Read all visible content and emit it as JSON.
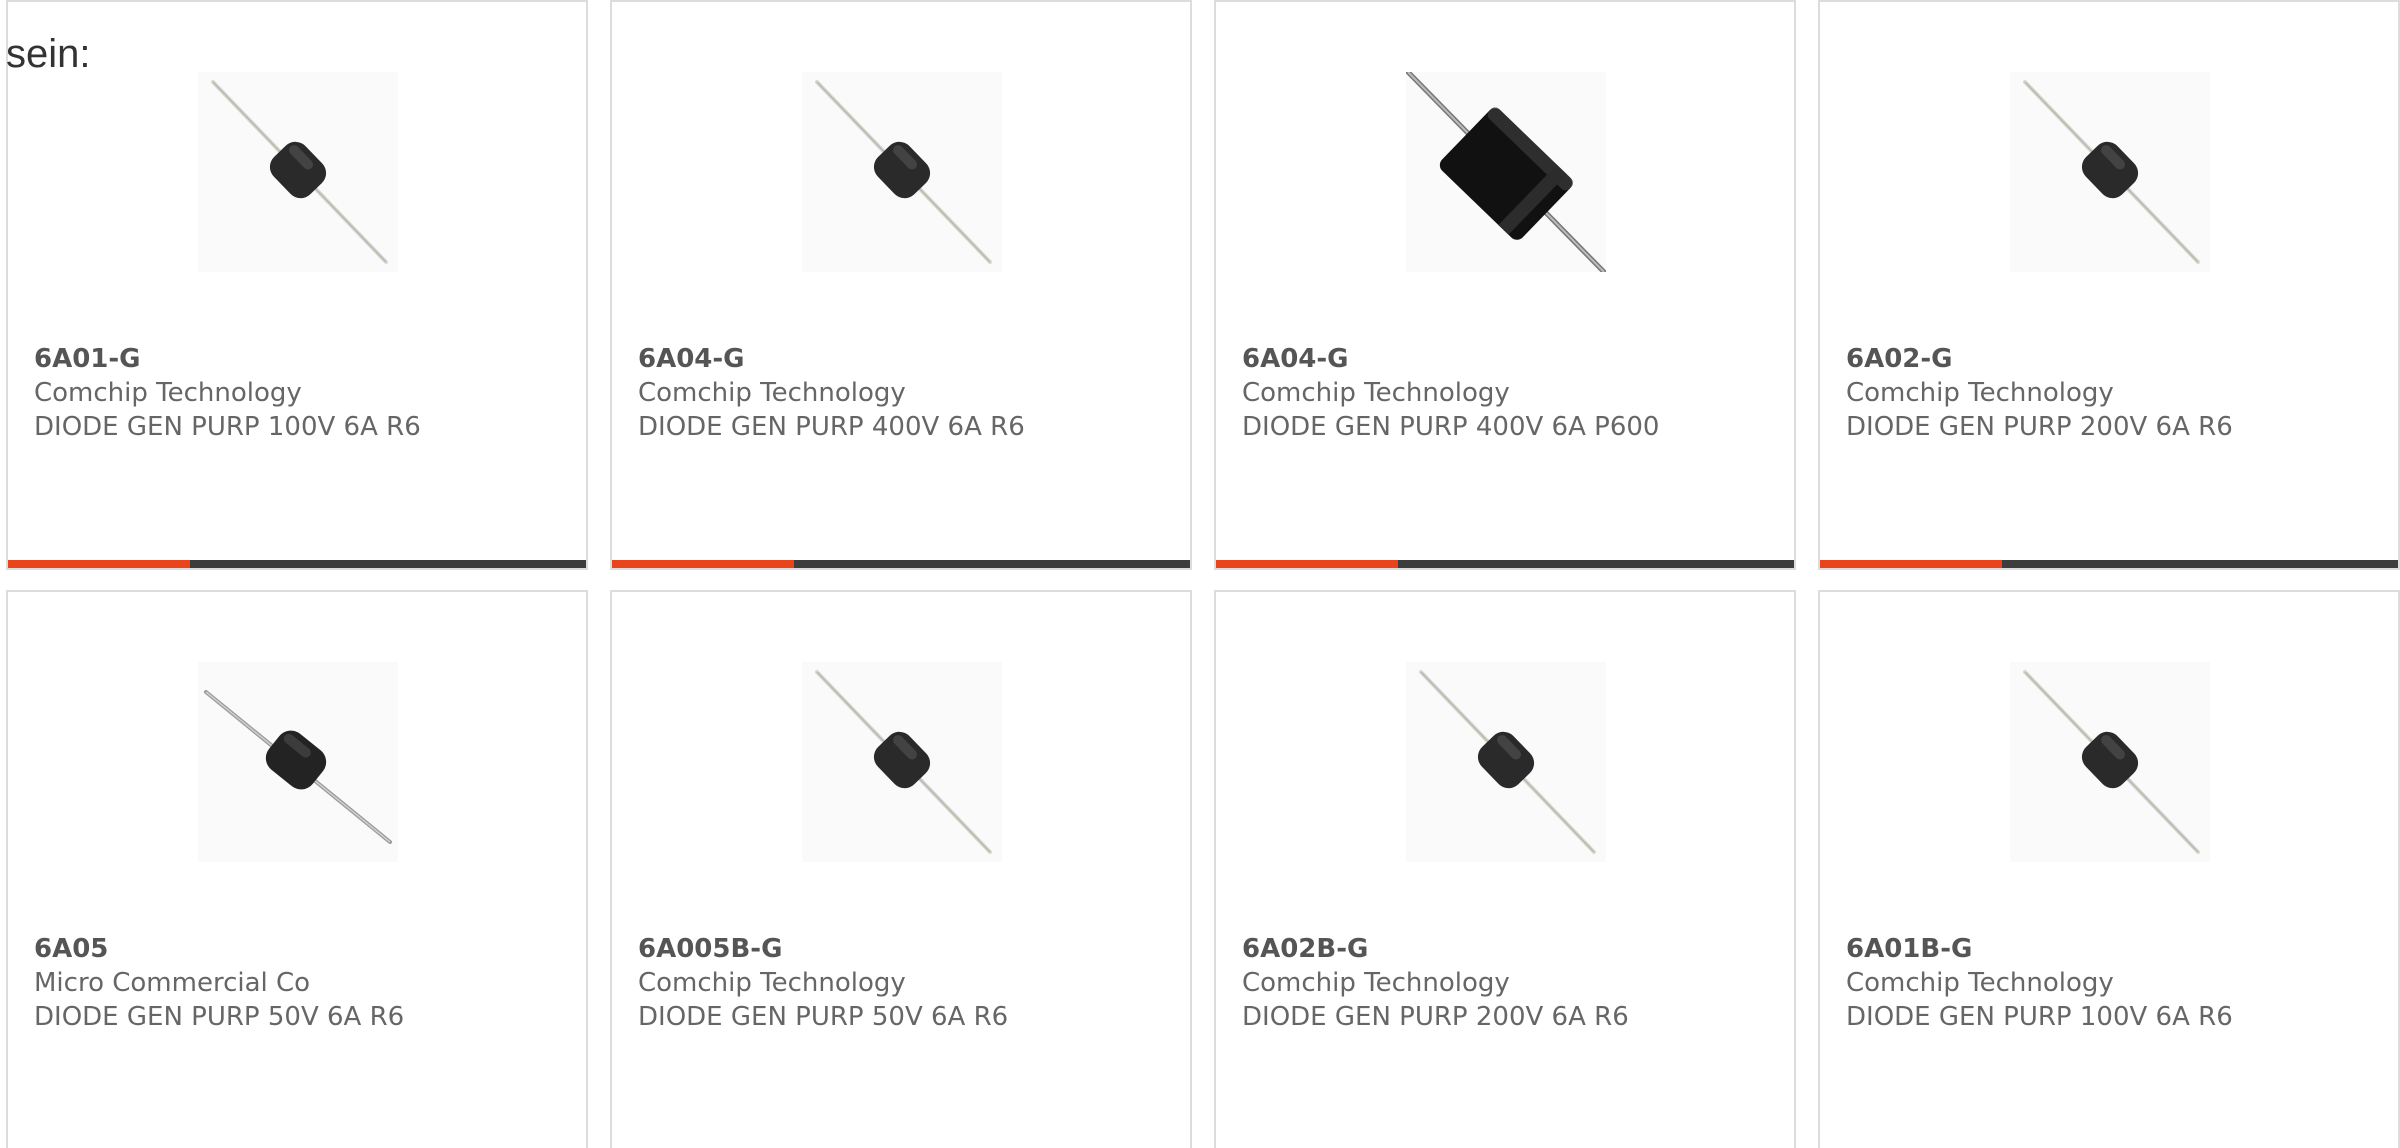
{
  "intro_text": "sein:",
  "colors": {
    "accent": "#e8451c",
    "bar": "#3d3d3d",
    "card_border": "#dcdcdc"
  },
  "products": [
    {
      "part": "6A01-G",
      "maker": "Comchip Technology",
      "desc": "DIODE GEN PURP 100V 6A R6",
      "image": "diode-r6-image",
      "accent_bar": true
    },
    {
      "part": "6A04-G",
      "maker": "Comchip Technology",
      "desc": "DIODE GEN PURP 400V 6A R6",
      "image": "diode-r6-image",
      "accent_bar": true
    },
    {
      "part": "6A04-G",
      "maker": "Comchip Technology",
      "desc": "DIODE GEN PURP 400V 6A P600",
      "image": "diode-p600-image",
      "accent_bar": true
    },
    {
      "part": "6A02-G",
      "maker": "Comchip Technology",
      "desc": "DIODE GEN PURP 200V 6A R6",
      "image": "diode-r6-image",
      "accent_bar": true
    },
    {
      "part": "6A05",
      "maker": "Micro Commercial Co",
      "desc": "DIODE GEN PURP 50V 6A R6",
      "image": "diode-r6-image",
      "accent_bar": false
    },
    {
      "part": "6A005B-G",
      "maker": "Comchip Technology",
      "desc": "DIODE GEN PURP 50V 6A R6",
      "image": "diode-r6-image",
      "accent_bar": false
    },
    {
      "part": "6A02B-G",
      "maker": "Comchip Technology",
      "desc": "DIODE GEN PURP 200V 6A R6",
      "image": "diode-r6-image",
      "accent_bar": false
    },
    {
      "part": "6A01B-G",
      "maker": "Comchip Technology",
      "desc": "DIODE GEN PURP 100V 6A R6",
      "image": "diode-r6-image",
      "accent_bar": false
    }
  ]
}
